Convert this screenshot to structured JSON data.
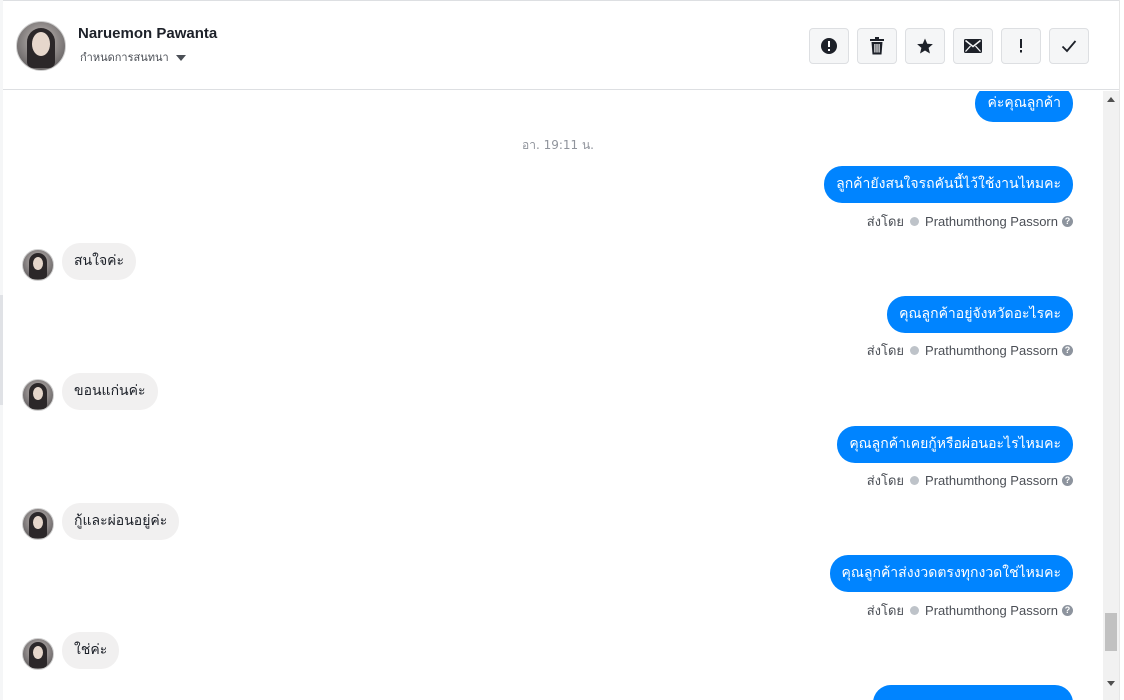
{
  "header": {
    "name": "Naruemon Pawanta",
    "subtitle": "กำหนดการสนทนา"
  },
  "toolbar": {
    "buttons": [
      {
        "icon": "alert-circle-icon",
        "label": "report"
      },
      {
        "icon": "trash-icon",
        "label": "delete"
      },
      {
        "icon": "star-icon",
        "label": "star"
      },
      {
        "icon": "envelope-icon",
        "label": "mark unread"
      },
      {
        "icon": "exclamation-icon",
        "label": "important"
      },
      {
        "icon": "checkmark-icon",
        "label": "done"
      }
    ]
  },
  "chat": {
    "timestamp": "อา. 19:11 น.",
    "sent_by_label": "ส่งโดย",
    "sender_name": "Prathumthong Passorn",
    "messages": [
      {
        "direction": "out",
        "text": "ค่ะคุณลูกค้า"
      },
      {
        "direction": "out",
        "text": "ลูกค้ายังสนใจรถคันนี้ไว้ใช้งานไหมคะ"
      },
      {
        "direction": "in",
        "text": "สนใจค่ะ"
      },
      {
        "direction": "out",
        "text": "คุณลูกค้าอยู่จังหวัดอะไรคะ"
      },
      {
        "direction": "in",
        "text": "ขอนแก่นค่ะ"
      },
      {
        "direction": "out",
        "text": "คุณลูกค้าเคยกู้หรือผ่อนอะไรไหมคะ"
      },
      {
        "direction": "in",
        "text": "กู้และผ่อนอยู่ค่ะ"
      },
      {
        "direction": "out",
        "text": "คุณลูกค้าส่งงวดตรงทุกงวดใช่ไหมคะ"
      },
      {
        "direction": "in",
        "text": "ใช่ค่ะ"
      }
    ]
  },
  "colors": {
    "outgoing_bubble": "#0084ff",
    "incoming_bubble": "#f1f0f0",
    "text_primary": "#1d2129",
    "text_secondary": "#4b4f56"
  }
}
